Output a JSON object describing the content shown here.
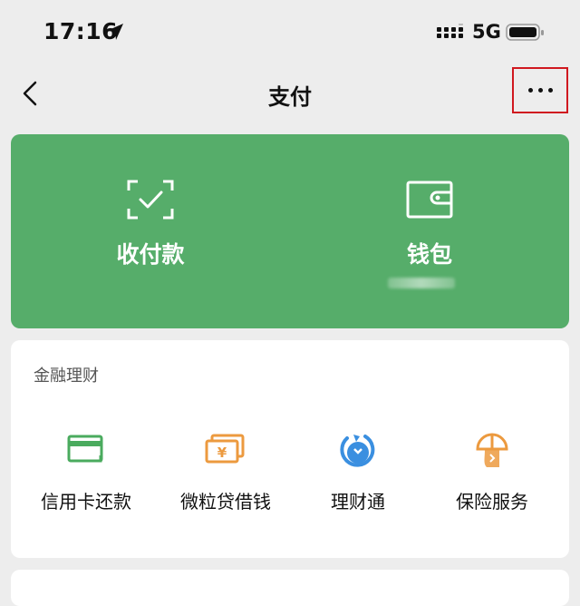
{
  "status_bar": {
    "time": "17:16",
    "network": "5G",
    "icons": [
      "location-arrow-icon",
      "cellular-signal-icon",
      "battery-icon"
    ]
  },
  "nav": {
    "title": "支付",
    "icons": [
      "chevron-left-icon",
      "more-dots-icon"
    ],
    "highlight_color": "#d0181f"
  },
  "top_card": {
    "color": "#56ad6a",
    "pay": {
      "label": "收付款",
      "icon": "scan-check-icon"
    },
    "wallet": {
      "label": "钱包",
      "icon": "wallet-icon"
    }
  },
  "finance": {
    "title": "金融理财",
    "items": [
      {
        "label": "信用卡还款",
        "icon": "credit-card-icon",
        "color": "#4aab5e"
      },
      {
        "label": "微粒贷借钱",
        "icon": "yuan-bills-icon",
        "color": "#ec9a3f"
      },
      {
        "label": "理财通",
        "icon": "licaitong-icon",
        "color": "#3a8fe0"
      },
      {
        "label": "保险服务",
        "icon": "insurance-umbrella-icon",
        "color": "#ec9a3f"
      }
    ]
  }
}
